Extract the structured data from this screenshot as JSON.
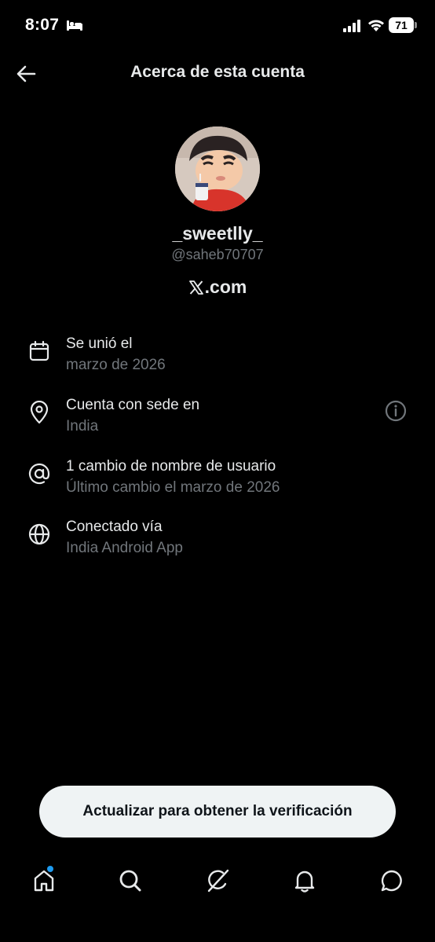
{
  "status_bar": {
    "time": "8:07",
    "battery": "71",
    "icons": [
      "bed-icon",
      "signal-icon",
      "wifi-icon",
      "battery-icon"
    ]
  },
  "header": {
    "back_icon": "arrow-left-icon",
    "title": "Acerca de esta cuenta"
  },
  "profile": {
    "avatar": "avatar",
    "display_name": "_sweetlly_",
    "handle": "@saheb70707",
    "site": ".com",
    "site_logo": "x-logo-icon"
  },
  "info": [
    {
      "icon": "calendar-icon",
      "title": "Se unió el",
      "subtitle": "marzo de 2026"
    },
    {
      "icon": "location-pin-icon",
      "title": "Cuenta con sede en",
      "subtitle": "India",
      "action_icon": "info-circle-icon"
    },
    {
      "icon": "at-sign-icon",
      "title": "1 cambio de nombre de usuario",
      "subtitle": "Último cambio el marzo de 2026"
    },
    {
      "icon": "globe-icon",
      "title": "Conectado vía",
      "subtitle": "India Android App"
    }
  ],
  "upgrade_button": {
    "label": "Actualizar para obtener la verificación"
  },
  "bottom_nav": {
    "items": [
      "home-icon",
      "search-icon",
      "grok-icon",
      "notifications-bell-icon",
      "messages-icon"
    ],
    "accent_color": "#1d9bf0"
  },
  "colors": {
    "background": "#000000",
    "primary_text": "#e7e9ea",
    "secondary_text": "#71767b",
    "button_background": "#eff3f4"
  }
}
